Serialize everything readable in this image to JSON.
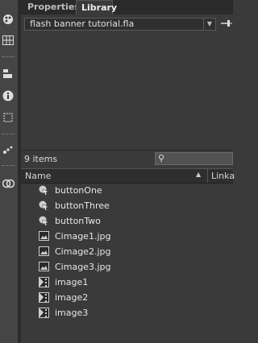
{
  "tabs": [
    "Properties",
    "Library"
  ],
  "active_tab": "Library",
  "document": {
    "name": "flash banner tutorial.fla"
  },
  "item_count": "9 items",
  "search": {
    "placeholder": ""
  },
  "columns": [
    "Name",
    "Linka"
  ],
  "items": [
    {
      "label": "buttonOne",
      "type": "button"
    },
    {
      "label": "buttonThree",
      "type": "button"
    },
    {
      "label": "buttonTwo",
      "type": "button"
    },
    {
      "label": "Cimage1.jpg",
      "type": "bitmap"
    },
    {
      "label": "Cimage2.jpg",
      "type": "bitmap"
    },
    {
      "label": "Cimage3.jpg",
      "type": "bitmap"
    },
    {
      "label": "image1",
      "type": "movieclip"
    },
    {
      "label": "image2",
      "type": "movieclip"
    },
    {
      "label": "image3",
      "type": "movieclip"
    }
  ],
  "toolstrip_icons": [
    "color-palette-icon",
    "grid-icon",
    "align-icon",
    "info-icon",
    "transform-icon",
    "brush-icon",
    "swatch-icon"
  ]
}
